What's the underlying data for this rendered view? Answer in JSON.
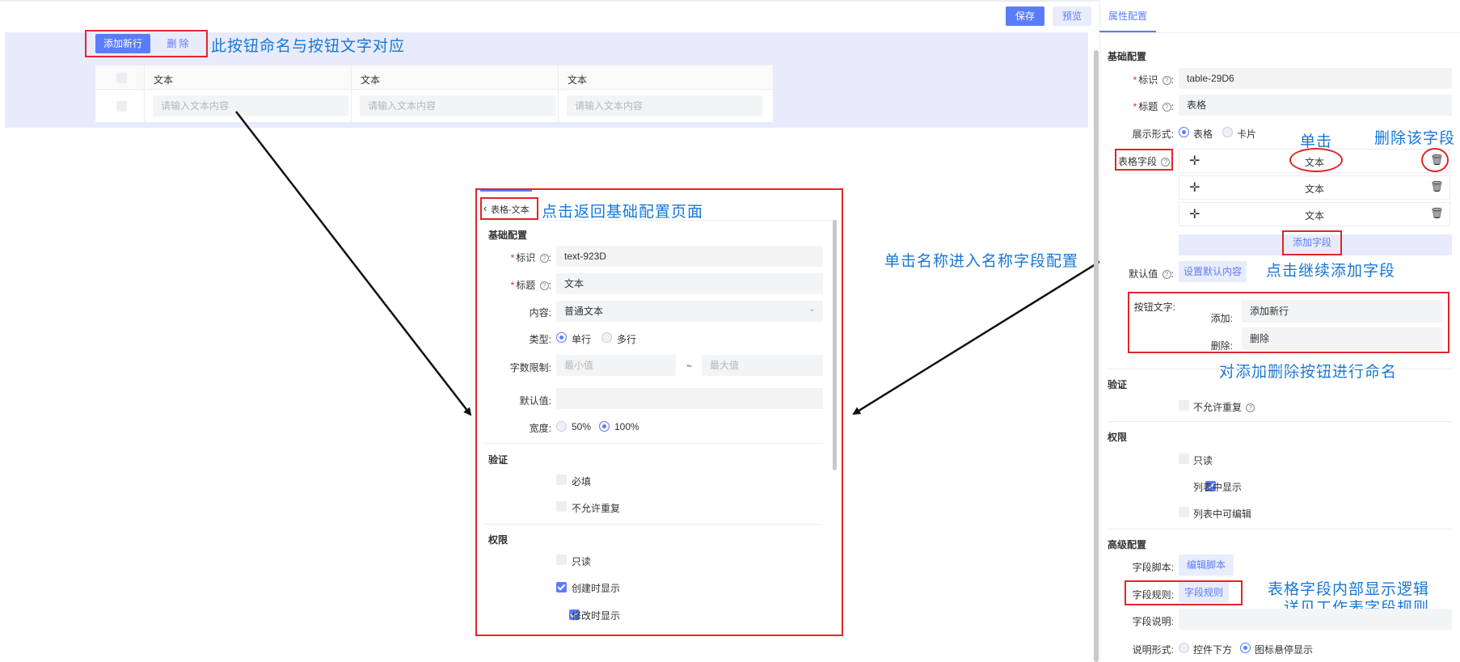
{
  "toolbar": {
    "save_label": "保存",
    "preview_label": "预览"
  },
  "canvas": {
    "add_row_button": "添加新行",
    "delete_button": "删 除",
    "columns": [
      "文本",
      "文本",
      "文本"
    ],
    "cell_placeholder": "请输入文本内容"
  },
  "annotations": {
    "button_naming": "此按钮命名与按钮文字对应",
    "back_to_basic": "点击返回基础配置页面",
    "click_name": "单击名称进入名称字段配置",
    "single_click": "单击",
    "delete_field": "删除该字段",
    "continue_add": "点击继续添加字段",
    "rename_buttons": "对添加删除按钮进行命名",
    "logic_line1": "表格字段内部显示逻辑",
    "logic_line2": "，详见工作表字段规则"
  },
  "field_panel": {
    "back_label": "表格-文本",
    "basic_title": "基础配置",
    "id_label": "标识",
    "id_value": "text-923D",
    "title_label": "标题",
    "title_value": "文本",
    "content_label": "内容:",
    "content_value": "普通文本",
    "type_label": "类型:",
    "type_single": "单行",
    "type_multi": "多行",
    "limit_label": "字数限制:",
    "limit_min": "最小值",
    "limit_sep": "~",
    "limit_max": "最大值",
    "default_label": "默认值:",
    "width_label": "宽度:",
    "width_50": "50%",
    "width_100": "100%",
    "validate_title": "验证",
    "required": "必填",
    "no_duplicate": "不允许重复",
    "perm_title": "权限",
    "readonly": "只读",
    "show_on_create": "创建时显示",
    "show_on_edit": "修改时显示"
  },
  "right_panel": {
    "tab": "属性配置",
    "basic_title": "基础配置",
    "id_label": "标识",
    "id_value": "table-29D6",
    "title_label": "标题",
    "title_value": "表格",
    "display_label": "展示形式:",
    "display_table": "表格",
    "display_card": "卡片",
    "fields_label": "表格字段",
    "fields": [
      "文本",
      "文本",
      "文本"
    ],
    "add_field": "添加字段",
    "default_label": "默认值",
    "default_button": "设置默认内容",
    "btn_text_label": "按钮文字:",
    "add_label": "添加:",
    "add_value": "添加新行",
    "delete_label": "删除:",
    "delete_value": "删除",
    "validate_title": "验证",
    "no_duplicate": "不允许重复",
    "perm_title": "权限",
    "readonly": "只读",
    "show_in_list": "列表中显示",
    "edit_in_list": "列表中可编辑",
    "advanced_title": "高级配置",
    "script_label": "字段脚本:",
    "script_button": "编辑脚本",
    "rule_label": "字段规则:",
    "rule_button": "字段规则",
    "desc_label": "字段说明:",
    "desc_form_label": "说明形式:",
    "desc_below": "控件下方",
    "desc_hover": "图标悬停显示"
  }
}
